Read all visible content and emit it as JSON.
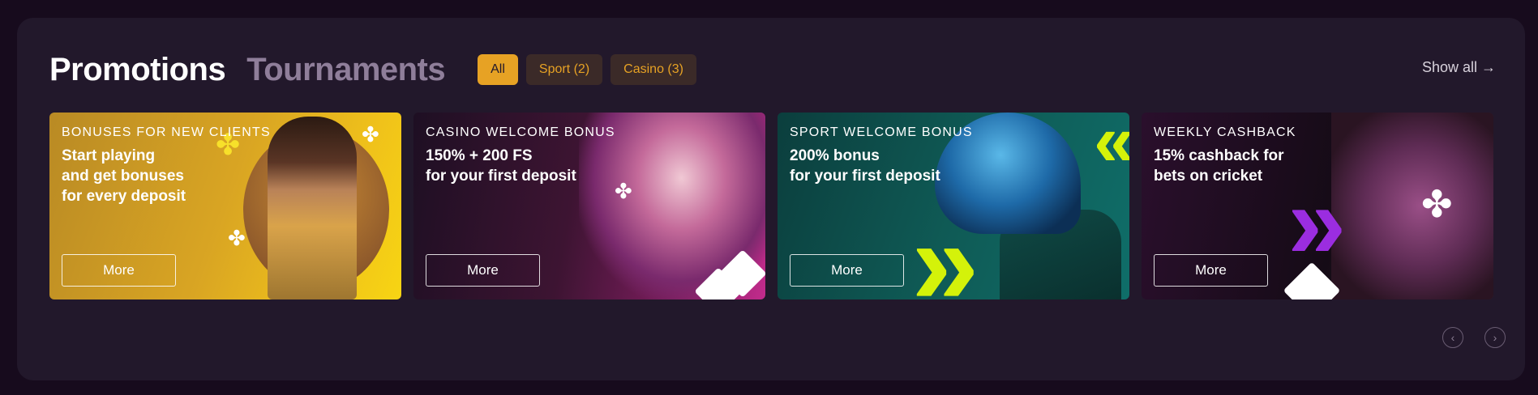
{
  "header": {
    "tab_promotions": "Promotions",
    "tab_tournaments": "Tournaments",
    "filters": [
      {
        "label": "All",
        "active": true
      },
      {
        "label": "Sport (2)",
        "active": false
      },
      {
        "label": "Casino (3)",
        "active": false
      }
    ],
    "show_all": "Show all →"
  },
  "cards": [
    {
      "eyebrow": "BONUSES FOR NEW CLIENTS",
      "lines": [
        "Start playing",
        "and get bonuses",
        "for every deposit"
      ],
      "button": "More"
    },
    {
      "eyebrow": "CASINO WELCOME BONUS",
      "lines": [
        "150% + 200 FS",
        "for your first deposit"
      ],
      "button": "More"
    },
    {
      "eyebrow": "SPORT WELCOME BONUS",
      "lines": [
        "200% bonus",
        "for your first deposit"
      ],
      "button": "More"
    },
    {
      "eyebrow": "WEEKLY CASHBACK",
      "lines": [
        "15% cashback for",
        "bets on cricket"
      ],
      "button": "More"
    }
  ],
  "pager": {
    "prev_icon": "‹",
    "next_icon": "›"
  },
  "colors": {
    "accent": "#e7a224",
    "panel": "#22182b",
    "background": "#170b1d"
  }
}
